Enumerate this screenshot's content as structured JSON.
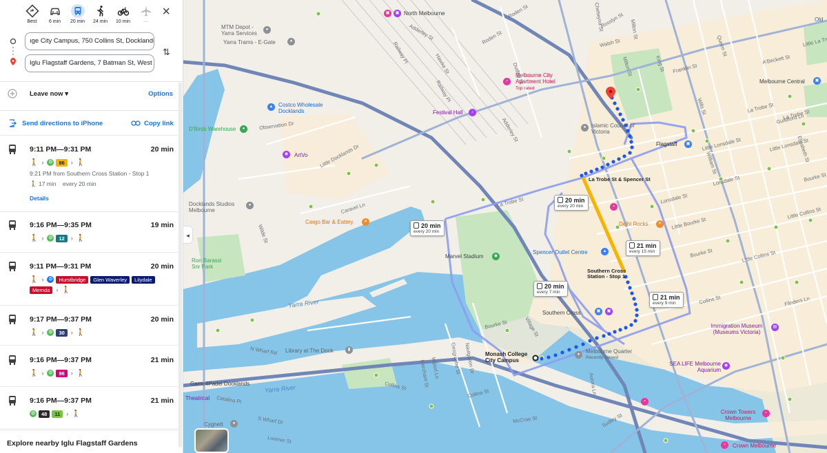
{
  "modes": [
    {
      "name": "best",
      "label": "Best",
      "icon": "diamond-route-icon",
      "active": false
    },
    {
      "name": "car",
      "label": "6 min",
      "icon": "car-icon",
      "active": false
    },
    {
      "name": "transit",
      "label": "20 min",
      "icon": "bus-icon",
      "active": true
    },
    {
      "name": "walk",
      "label": "24 min",
      "icon": "walk-icon",
      "active": false
    },
    {
      "name": "bike",
      "label": "10 min",
      "icon": "bike-icon",
      "active": false
    },
    {
      "name": "flight",
      "label": "—",
      "icon": "plane-icon",
      "active": false
    }
  ],
  "origin": "ıge City Campus, 750 Collins St, Docklands",
  "destination": "Iglu Flagstaff Gardens, 7 Batman St, West",
  "leave_now": "Leave now",
  "options": "Options",
  "send_to_phone": "Send directions to iPhone",
  "copy_link": "Copy link",
  "routes": [
    {
      "time": "9:11 PM—9:31 PM",
      "duration": "20 min",
      "lines": [
        "86"
      ],
      "detail": "9:21 PM from Southern Cross Station - Stop 1",
      "walk": "17 min",
      "freq": "every 20 min",
      "details_link": "Details"
    },
    {
      "time": "9:16 PM—9:35 PM",
      "duration": "19 min",
      "lines": [
        "12"
      ]
    },
    {
      "time": "9:11 PM—9:31 PM",
      "duration": "20 min",
      "lines": [
        "Hurstbridge",
        "Glen Waverley",
        "Lilydale",
        "Mernda"
      ]
    },
    {
      "time": "9:17 PM—9:37 PM",
      "duration": "20 min",
      "lines": [
        "30"
      ]
    },
    {
      "time": "9:16 PM—9:37 PM",
      "duration": "21 min",
      "lines": [
        "96"
      ]
    },
    {
      "time": "9:16 PM—9:37 PM",
      "duration": "21 min",
      "lines": [
        "48",
        "11"
      ]
    }
  ],
  "explore": "Explore nearby Iglu Flagstaff Gardens",
  "colors": {
    "route_blue": "#1a56f0",
    "route_outline": "#8b9df0",
    "tram_yellow": "#f5b400",
    "water": "#86c5e8",
    "park": "#c7e6c0",
    "tram_green": "#5bb85b"
  },
  "map": {
    "callouts": [
      {
        "time": "20 min",
        "freq": "every 20 min"
      },
      {
        "time": "20 min",
        "freq": "every 20 min"
      },
      {
        "time": "21 min",
        "freq": "every 15 min"
      },
      {
        "time": "20 min",
        "freq": "every 7 min"
      },
      {
        "time": "21 min",
        "freq": "every 9 min"
      }
    ],
    "labels": {
      "north_melbourne": "North Melbourne",
      "mtm_depot": "MTM Depot - Yarra Services",
      "yarra_trams": "Yarra Trams - E-Gate",
      "melbourne_city_apartment": "Melbourne City Apartment Hotel",
      "top_rated": "Top rated",
      "costco": "Costco Wholesale Docklands",
      "observation_dr": "Observation Dr",
      "festival_hall": "Festival Hall",
      "islamic_council": "Islamic Council of Victoria",
      "flagstaff": "Flagstaff",
      "dbirds_warehouse": "D'Birds Warehouse",
      "artvo": "ArtVo",
      "la_trobe_spencer": "La Trobe St & Spencer St",
      "docklands_studios": "Docklands Studios Melbourne",
      "cargo_bar": "Cargo Bar & Eatery",
      "delhi_rocks": "Delhi Rocks",
      "marvel_stadium": "Marvel Stadium",
      "spencer_outlet": "Spencer Outlet Centre",
      "southern_cross_station_stop": "Southern Cross Station - Stop 1",
      "ron_barassi": "Ron Barassi Snr Park",
      "yarra_river": "Yarra River",
      "southern_cross": "Southern Cross",
      "library_dock": "Library at The Dock",
      "monash_campus": "Monash College City Campus",
      "melbourne_quarter": "Melbourne Quarter",
      "recently_viewed": "Recently viewed",
      "immigration_museum": "Immigration Museum (Museums Victoria)",
      "sea_life": "SEA LIFE Melbourne Aquarium",
      "game4padel": "Game4Padel Docklands",
      "theatrical": "Theatrical",
      "cygnett": "Cygnett",
      "crown_towers": "Crown Towers Melbourne",
      "crown_melbourne": "Crown Melbourne",
      "melbourne_central": "Melbourne Central",
      "old": "Old",
      "abeckett_st": "A'Beckett St",
      "la_trobe_st": "La Trobe St",
      "lonsdale_st": "Lonsdale St",
      "bourke_st": "Bourke St",
      "collins_st": "Collins St",
      "flinders_ln": "Flinders Ln",
      "little_lonsdale": "Little Lonsdale St",
      "little_bourke": "Little Bourke St",
      "little_collins": "Little Collins St",
      "william_st": "William St",
      "queen_st": "Queen St",
      "king_st": "King St",
      "spencer_st": "Spencer St",
      "franklin_st": "Franklin St",
      "walsh_st": "Walsh St",
      "rosslyn_st": "Rosslyn St",
      "roden_st": "Roden St",
      "adderley_st": "Adderley St",
      "railway_pl": "Railway Pl",
      "hawke_st": "Hawke St",
      "dudley_st": "Dudley St",
      "little_docklands_dr": "Little Docklands Dr",
      "caravel_ln": "Caravel Ln",
      "bourke_st_dock": "Bourke St",
      "village_st": "Village St",
      "n_wharf_rd": "N Wharf Rd",
      "s_wharf_dr": "S Wharf Dr",
      "collins_st_dock": "Collins St",
      "merchant_st": "Merchant St",
      "mccrae_st": "McCrae St",
      "sudley_st": "Sudley St",
      "aurora_ln": "Aurora Ln",
      "loorner_st": "Loorner St",
      "wurundjeri_way": "Wurundjeri Way",
      "pearl_river_rd": "Pearl River Rd",
      "catalina_pl": "Catalina Pl",
      "milton_st": "Milton St",
      "chetwynd_st": "Chetwynd St",
      "guildford_ln": "Guildford Ln",
      "little_la_trobe": "Little La Trobe St",
      "bourke_st_east": "Bourke St",
      "wills_st": "Wills St",
      "hardware_ln": "Hardware Ln",
      "navigation_dr": "Navigation Dr",
      "geographe_st": "Geographe St",
      "import_ln": "Import Ln",
      "elizabeth_st": "Elizabeth St",
      "flinders_st": "Flinders St",
      "wilde_st": "Wilde St",
      "little_latrobe_2": "Little La Trobe St"
    }
  }
}
